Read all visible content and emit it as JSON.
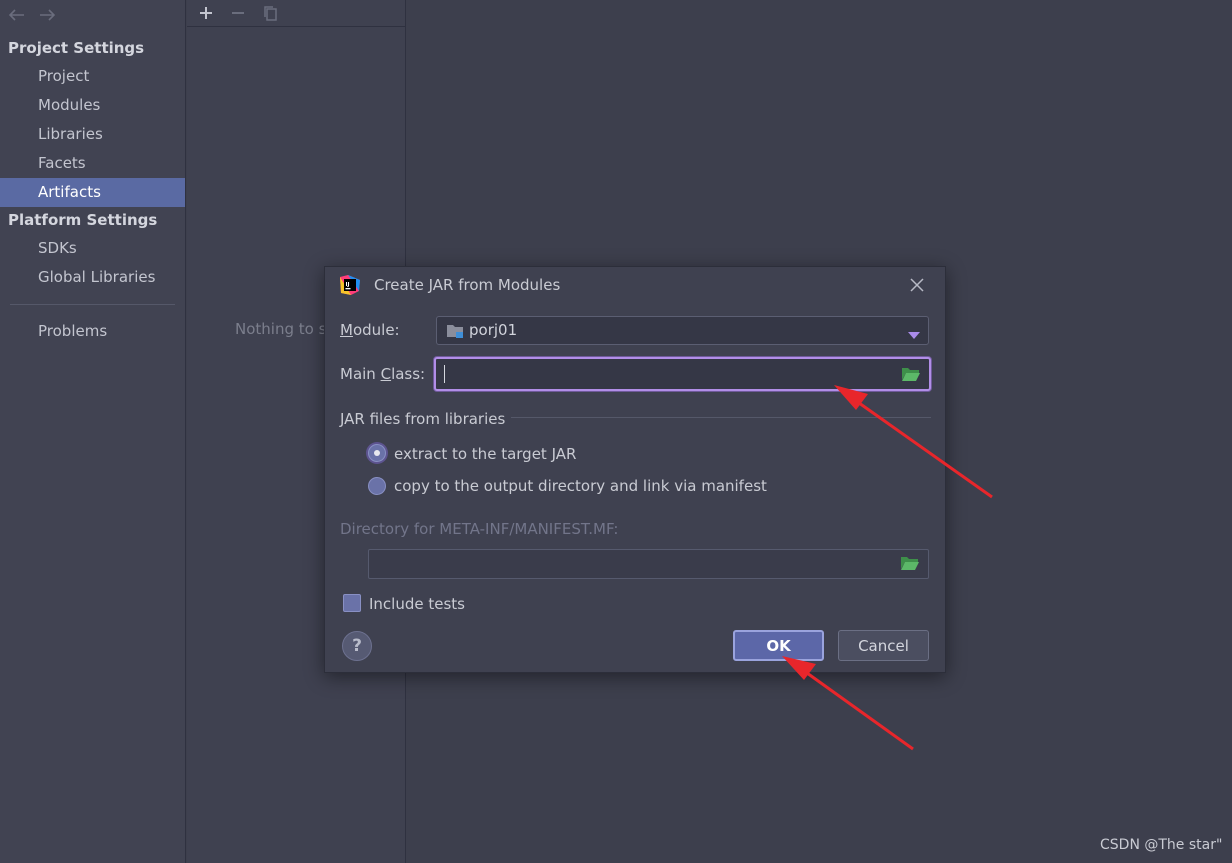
{
  "sidebar": {
    "project_settings_header": "Project Settings",
    "project_items": [
      "Project",
      "Modules",
      "Libraries",
      "Facets",
      "Artifacts"
    ],
    "platform_settings_header": "Platform Settings",
    "platform_items": [
      "SDKs",
      "Global Libraries"
    ],
    "problems": "Problems",
    "selected": "Artifacts"
  },
  "middle": {
    "empty_text": "Nothing to s"
  },
  "dialog": {
    "title": "Create JAR from Modules",
    "module_label_mnemonic": "M",
    "module_label_rest": "odule:",
    "module_value": "porj01",
    "main_class_label_pre": "Main ",
    "main_class_label_mnemonic": "C",
    "main_class_label_post": "lass:",
    "main_class_value": "",
    "jar_group_label": "JAR files from libraries",
    "radio_extract": "extract to the target JAR",
    "radio_copy": "copy to the output directory and link via manifest",
    "radio_selected": "extract",
    "manifest_dir_label": "Directory for META-INF/MANIFEST.MF:",
    "manifest_dir_value": "",
    "include_tests_label": "Include tests",
    "help_label": "?",
    "ok_label": "OK",
    "cancel_label": "Cancel"
  },
  "watermark": "CSDN @The star\"",
  "colors": {
    "selection": "#5a6aa3",
    "focus_ring": "#b28ee8",
    "annotation_arrow": "#e8262b",
    "browse_folder": "#4fa35a"
  }
}
